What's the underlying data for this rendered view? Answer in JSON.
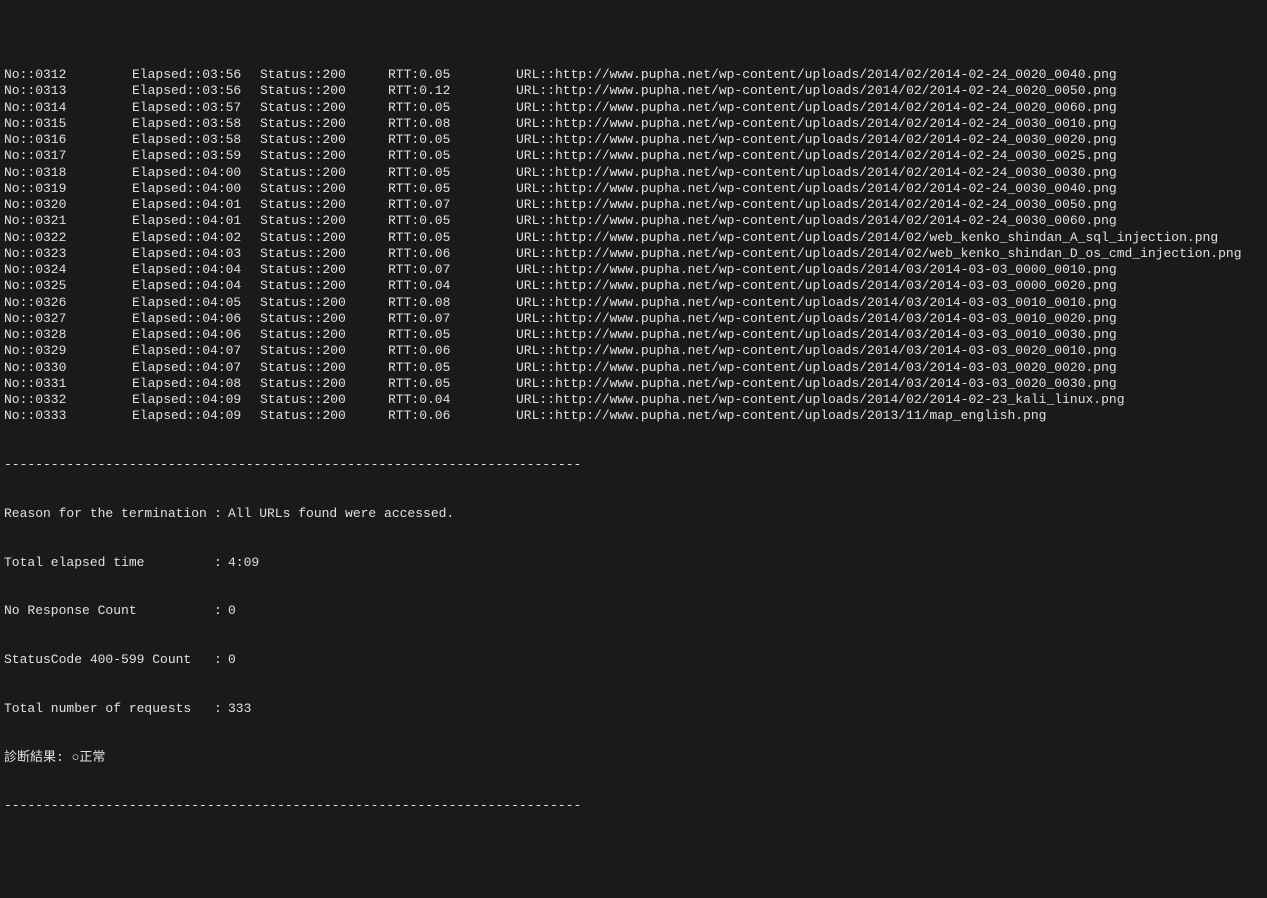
{
  "rows": [
    {
      "no": "0312",
      "elapsed": "03:56",
      "status": "200",
      "rtt": "0.05",
      "url": "http://www.pupha.net/wp-content/uploads/2014/02/2014-02-24_0020_0040.png"
    },
    {
      "no": "0313",
      "elapsed": "03:56",
      "status": "200",
      "rtt": "0.12",
      "url": "http://www.pupha.net/wp-content/uploads/2014/02/2014-02-24_0020_0050.png"
    },
    {
      "no": "0314",
      "elapsed": "03:57",
      "status": "200",
      "rtt": "0.05",
      "url": "http://www.pupha.net/wp-content/uploads/2014/02/2014-02-24_0020_0060.png"
    },
    {
      "no": "0315",
      "elapsed": "03:58",
      "status": "200",
      "rtt": "0.08",
      "url": "http://www.pupha.net/wp-content/uploads/2014/02/2014-02-24_0030_0010.png"
    },
    {
      "no": "0316",
      "elapsed": "03:58",
      "status": "200",
      "rtt": "0.05",
      "url": "http://www.pupha.net/wp-content/uploads/2014/02/2014-02-24_0030_0020.png"
    },
    {
      "no": "0317",
      "elapsed": "03:59",
      "status": "200",
      "rtt": "0.05",
      "url": "http://www.pupha.net/wp-content/uploads/2014/02/2014-02-24_0030_0025.png"
    },
    {
      "no": "0318",
      "elapsed": "04:00",
      "status": "200",
      "rtt": "0.05",
      "url": "http://www.pupha.net/wp-content/uploads/2014/02/2014-02-24_0030_0030.png"
    },
    {
      "no": "0319",
      "elapsed": "04:00",
      "status": "200",
      "rtt": "0.05",
      "url": "http://www.pupha.net/wp-content/uploads/2014/02/2014-02-24_0030_0040.png"
    },
    {
      "no": "0320",
      "elapsed": "04:01",
      "status": "200",
      "rtt": "0.07",
      "url": "http://www.pupha.net/wp-content/uploads/2014/02/2014-02-24_0030_0050.png"
    },
    {
      "no": "0321",
      "elapsed": "04:01",
      "status": "200",
      "rtt": "0.05",
      "url": "http://www.pupha.net/wp-content/uploads/2014/02/2014-02-24_0030_0060.png"
    },
    {
      "no": "0322",
      "elapsed": "04:02",
      "status": "200",
      "rtt": "0.05",
      "url": "http://www.pupha.net/wp-content/uploads/2014/02/web_kenko_shindan_A_sql_injection.png"
    },
    {
      "no": "0323",
      "elapsed": "04:03",
      "status": "200",
      "rtt": "0.06",
      "url": "http://www.pupha.net/wp-content/uploads/2014/02/web_kenko_shindan_D_os_cmd_injection.png"
    },
    {
      "no": "0324",
      "elapsed": "04:04",
      "status": "200",
      "rtt": "0.07",
      "url": "http://www.pupha.net/wp-content/uploads/2014/03/2014-03-03_0000_0010.png"
    },
    {
      "no": "0325",
      "elapsed": "04:04",
      "status": "200",
      "rtt": "0.04",
      "url": "http://www.pupha.net/wp-content/uploads/2014/03/2014-03-03_0000_0020.png"
    },
    {
      "no": "0326",
      "elapsed": "04:05",
      "status": "200",
      "rtt": "0.08",
      "url": "http://www.pupha.net/wp-content/uploads/2014/03/2014-03-03_0010_0010.png"
    },
    {
      "no": "0327",
      "elapsed": "04:06",
      "status": "200",
      "rtt": "0.07",
      "url": "http://www.pupha.net/wp-content/uploads/2014/03/2014-03-03_0010_0020.png"
    },
    {
      "no": "0328",
      "elapsed": "04:06",
      "status": "200",
      "rtt": "0.05",
      "url": "http://www.pupha.net/wp-content/uploads/2014/03/2014-03-03_0010_0030.png"
    },
    {
      "no": "0329",
      "elapsed": "04:07",
      "status": "200",
      "rtt": "0.06",
      "url": "http://www.pupha.net/wp-content/uploads/2014/03/2014-03-03_0020_0010.png"
    },
    {
      "no": "0330",
      "elapsed": "04:07",
      "status": "200",
      "rtt": "0.05",
      "url": "http://www.pupha.net/wp-content/uploads/2014/03/2014-03-03_0020_0020.png"
    },
    {
      "no": "0331",
      "elapsed": "04:08",
      "status": "200",
      "rtt": "0.05",
      "url": "http://www.pupha.net/wp-content/uploads/2014/03/2014-03-03_0020_0030.png"
    },
    {
      "no": "0332",
      "elapsed": "04:09",
      "status": "200",
      "rtt": "0.04",
      "url": "http://www.pupha.net/wp-content/uploads/2014/02/2014-02-23_kali_linux.png"
    },
    {
      "no": "0333",
      "elapsed": "04:09",
      "status": "200",
      "rtt": "0.06",
      "url": "http://www.pupha.net/wp-content/uploads/2013/11/map_english.png"
    }
  ],
  "labels": {
    "no_prefix": "No::",
    "elapsed_prefix": "Elapsed::",
    "status_prefix": "Status::",
    "rtt_prefix": "RTT:",
    "url_prefix": "URL::"
  },
  "divider": "--------------------------------------------------------------------------",
  "summary": {
    "reason_label": "Reason for the termination",
    "reason_value": "All URLs found were accessed.",
    "elapsed_label": "Total elapsed time",
    "elapsed_value": "4:09",
    "noresp_label": "No Response Count",
    "noresp_value": "0",
    "status4xx_label": "StatusCode 400-599 Count",
    "status4xx_value": "0",
    "total_label": "Total number of requests",
    "total_value": "333",
    "result_label": "診断結果:",
    "result_value": "○正常",
    "sep": ": "
  }
}
